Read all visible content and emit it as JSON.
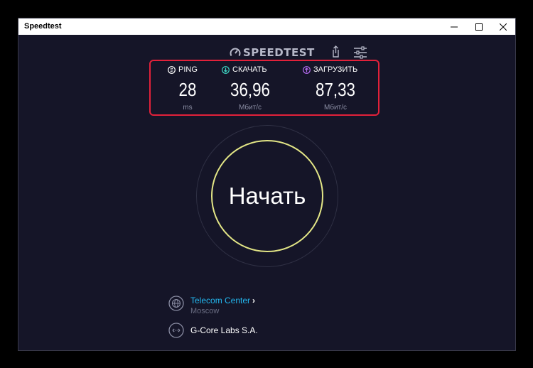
{
  "window": {
    "title": "Speedtest"
  },
  "header": {
    "brand": "SPEEDTEST"
  },
  "results": {
    "ping": {
      "label": "PING",
      "value": "28",
      "unit": "ms"
    },
    "download": {
      "label": "СКАЧАТЬ",
      "value": "36,96",
      "unit": "Мбит/с"
    },
    "upload": {
      "label": "ЗАГРУЗИТЬ",
      "value": "87,33",
      "unit": "Мбит/с"
    }
  },
  "go_button": {
    "label": "Начать"
  },
  "server": {
    "name": "Telecom Center",
    "location": "Moscow"
  },
  "isp": {
    "name": "G-Core Labs S.A."
  },
  "icons": {
    "ping": "ping-icon",
    "download": "download-arrow-icon",
    "upload": "upload-arrow-icon",
    "share": "share-icon",
    "settings": "settings-sliders-icon",
    "server": "globe-icon",
    "isp": "network-icon"
  },
  "colors": {
    "background": "#151528",
    "highlight_border": "#e2213a",
    "go_ring": "#e3e686",
    "download_accent": "#3ed3c2",
    "upload_accent": "#b46bf0",
    "link": "#23b8f0"
  }
}
